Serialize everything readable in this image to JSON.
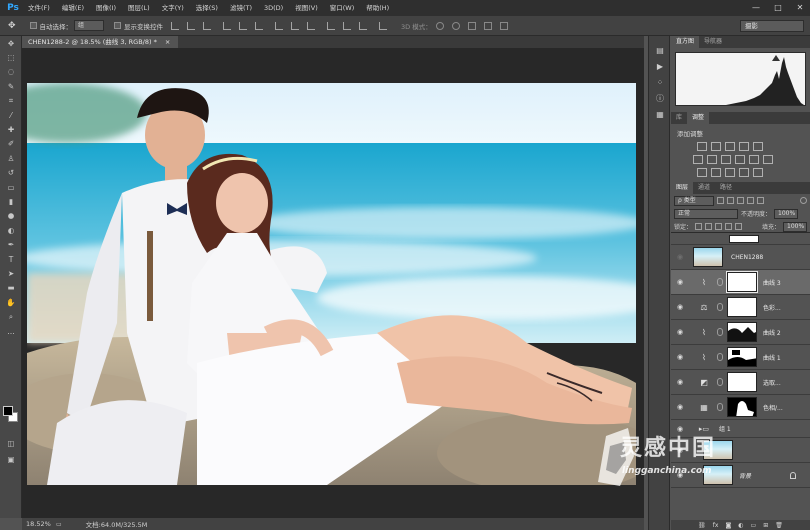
{
  "app": {
    "logo": "Ps"
  },
  "menu": [
    "文件(F)",
    "编辑(E)",
    "图像(I)",
    "图层(L)",
    "文字(Y)",
    "选择(S)",
    "滤镜(T)",
    "3D(D)",
    "视图(V)",
    "窗口(W)",
    "帮助(H)"
  ],
  "window_controls": [
    "—",
    "□",
    "✕"
  ],
  "options": {
    "auto_select_label": "自动选择：",
    "auto_select_value": "组",
    "show_transform_label": "显示变换控件",
    "mode_3d": "3D 模式：",
    "workspace": "摄影"
  },
  "document": {
    "tab_title": "CHEN1288-2 @ 18.5% (曲线 3, RGB/8) *",
    "close": "×"
  },
  "status": {
    "zoom": "18.52%",
    "doc_size": "文档:64.0M/325.5M"
  },
  "panels": {
    "top_tabs": [
      "直方图",
      "导航器"
    ],
    "mid_tabs": [
      "库",
      "调整"
    ],
    "adjustments_title": "添加调整",
    "layers_tabs": [
      "图层",
      "通道",
      "路径"
    ],
    "kind_filter": "ρ 类型",
    "blend_mode": "正常",
    "opacity_label": "不透明度：",
    "opacity_value": "100%",
    "lock_label": "锁定：",
    "fill_label": "填充：",
    "fill_value": "100%"
  },
  "layers": [
    {
      "name": "",
      "type": "mask-top"
    },
    {
      "name": "CHEN1288",
      "type": "smart"
    },
    {
      "name": "曲线 3",
      "type": "adj",
      "icon": "curves-icon",
      "selected": true
    },
    {
      "name": "色彩...",
      "type": "adj",
      "icon": "color-balance-icon"
    },
    {
      "name": "曲线 2",
      "type": "adj",
      "icon": "curves-icon",
      "mask": "dark-figure"
    },
    {
      "name": "曲线 1",
      "type": "adj",
      "icon": "curves-icon",
      "mask": "black-bottom"
    },
    {
      "name": "选取...",
      "type": "adj",
      "icon": "selective-color-icon"
    },
    {
      "name": "色相/...",
      "type": "adj",
      "icon": "hue-sat-icon",
      "mask": "black-figure"
    },
    {
      "name": "组 1",
      "type": "group"
    },
    {
      "name": "",
      "type": "photo"
    },
    {
      "name": "背景",
      "type": "background"
    }
  ],
  "watermark": {
    "text": "灵感中国",
    "url": "lingganchina.com"
  }
}
